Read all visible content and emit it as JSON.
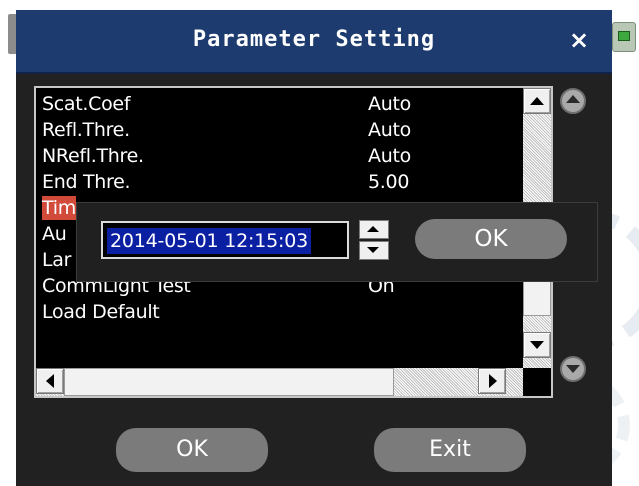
{
  "window": {
    "title": "Parameter Setting",
    "close_glyph": "×"
  },
  "list": {
    "rows": [
      {
        "label": "Scat.Coef",
        "value": "Auto"
      },
      {
        "label": "Refl.Thre.",
        "value": "Auto"
      },
      {
        "label": "NRefl.Thre.",
        "value": "Auto"
      },
      {
        "label": "End Thre.",
        "value": "5.00"
      },
      {
        "label": "Tim",
        "value": ""
      },
      {
        "label": "Au",
        "value": ""
      },
      {
        "label": "Lar",
        "value": ""
      },
      {
        "label": "CommLight Test",
        "value": "On"
      },
      {
        "label": "Load Default",
        "value": ""
      }
    ],
    "selected_index": 4
  },
  "datetime_popup": {
    "value": "2014-05-01 12:15:03",
    "ok_label": "OK"
  },
  "footer": {
    "ok_label": "OK",
    "exit_label": "Exit"
  },
  "colors": {
    "titlebar": "#1d3b6e",
    "selection": "#d14a3a",
    "input_highlight": "#0b1fa3",
    "button": "#7b7b7b"
  }
}
